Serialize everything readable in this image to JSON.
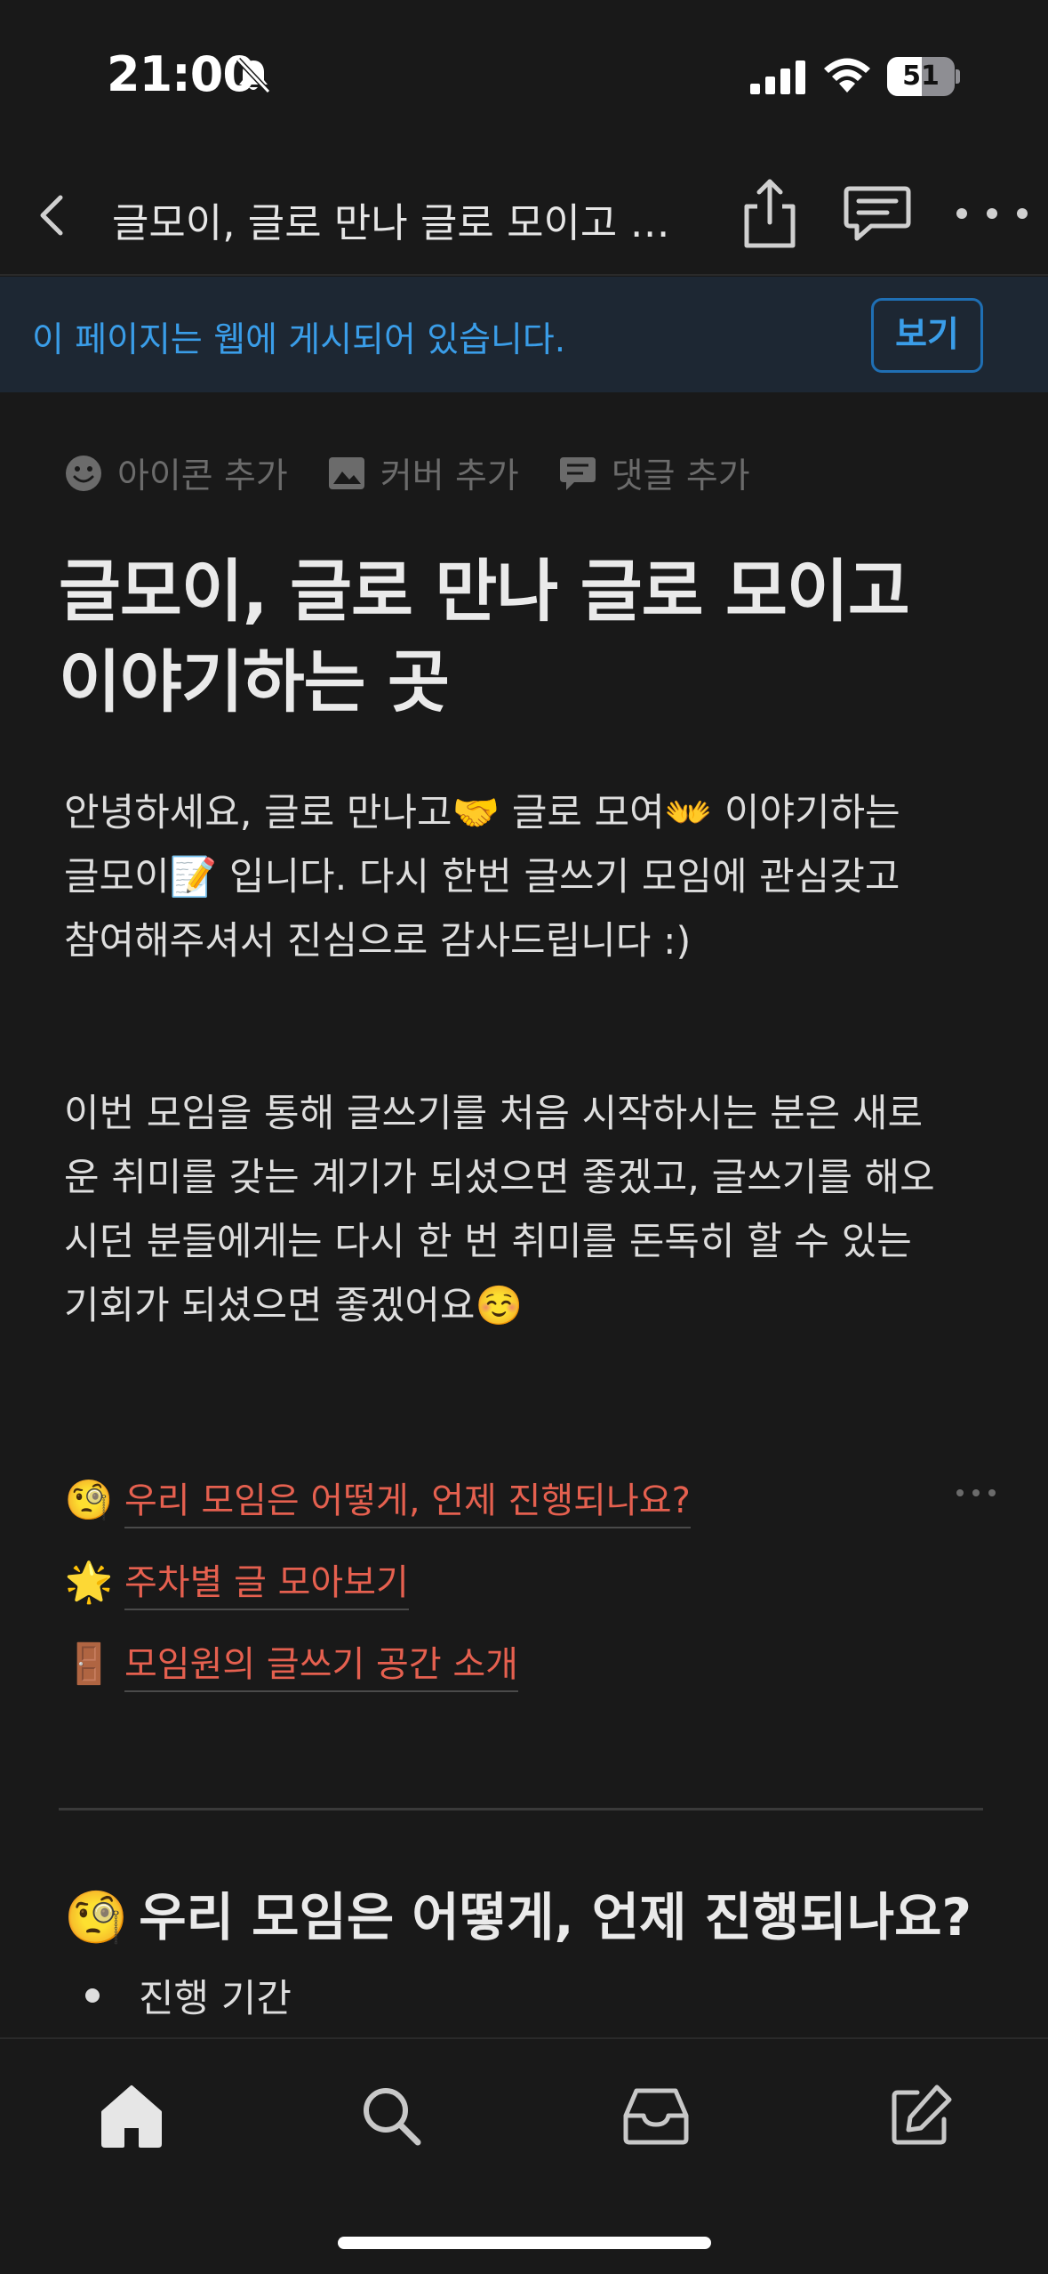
{
  "status_bar": {
    "time": "21:00",
    "battery_level": "51",
    "battery_fraction": 0.51
  },
  "nav": {
    "title": "글모이, 글로 만나 글로 모이고 이...",
    "back_icon": "chevron-left-icon",
    "share_icon": "share-icon",
    "comments_icon": "comment-icon",
    "more_icon": "ellipsis-icon"
  },
  "banner": {
    "text": "이 페이지는 웹에 게시되어 있습니다.",
    "view_label": "보기"
  },
  "page_actions": {
    "add_icon": "아이콘 추가",
    "add_cover": "커버 추가",
    "add_comment": "댓글 추가"
  },
  "page": {
    "title_line1": "글모이, 글로 만나 글로 모이고",
    "title_line2": "이야기하는 곳",
    "para1_line1": "안녕하세요, 글로 만나고🤝 글로 모여👐 이야기하는",
    "para1_line2": "글모이📝 입니다. 다시 한번 글쓰기 모임에 관심갖고",
    "para1_line3": "참여해주셔서 진심으로 감사드립니다 :)",
    "para2_line1": "이번 모임을 통해 글쓰기를 처음 시작하시는 분은 새로",
    "para2_line2": "운 취미를 갖는 계기가 되셨으면 좋겠고, 글쓰기를 해오",
    "para2_line3": "시던 분들에게는 다시 한 번 취미를 돈독히 할 수 있는",
    "para2_line4": "기회가 되셨으면 좋겠어요☺️",
    "links": [
      {
        "emoji": "🧐",
        "text": "우리 모임은 어떻게, 언제 진행되나요?"
      },
      {
        "emoji": "🌟",
        "text": "주차별 글 모아보기"
      },
      {
        "emoji": "🚪",
        "text": "모임원의 글쓰기 공간 소개"
      }
    ],
    "section_emoji": "🧐",
    "section_heading": "우리 모임은 어떻게, 언제 진행되나요?",
    "bullet_1": "진행 기간"
  },
  "tab_bar": {
    "items": [
      "home-icon",
      "search-icon",
      "inbox-icon",
      "new-page-icon"
    ]
  }
}
